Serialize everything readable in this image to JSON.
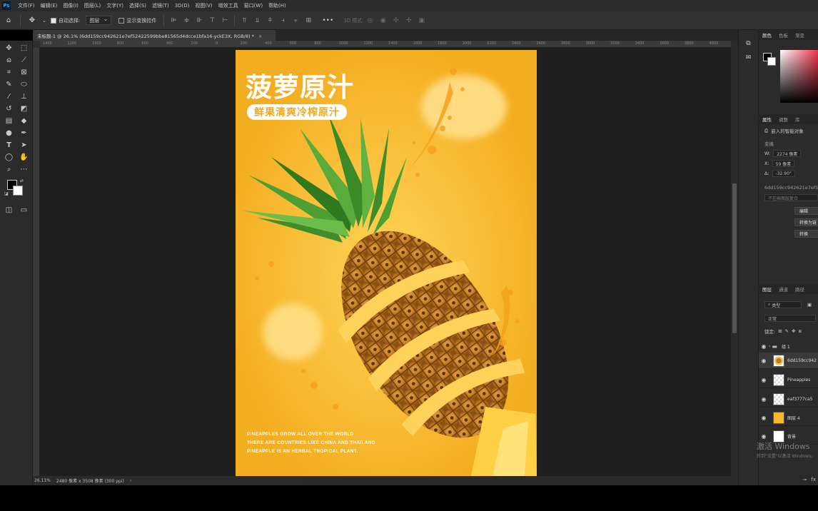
{
  "menubar": {
    "app_logo": "Ps",
    "items": [
      "文件(F)",
      "编辑(E)",
      "图像(I)",
      "图层(L)",
      "文字(Y)",
      "选择(S)",
      "滤镜(T)",
      "3D(D)",
      "视图(V)",
      "增效工具",
      "窗口(W)",
      "帮助(H)"
    ]
  },
  "options": {
    "auto_select_label": "自动选择:",
    "auto_select_target": "图层",
    "show_transform_label": "显示变换控件",
    "more": "•••",
    "mode_3d": "3D 模式:"
  },
  "tab": {
    "title": "未标题-1 @ 26.1% (6dd159cc942621e7ef52422599bbe81565d4dcce1bfa16-yckE3X, RGB/8) *",
    "close": "×"
  },
  "ruler": {
    "labels": [
      "1400",
      "1200",
      "1000",
      "800",
      "600",
      "400",
      "200",
      "0",
      "200",
      "400",
      "600",
      "800",
      "1000",
      "1200",
      "1400",
      "1600",
      "1800",
      "2000",
      "2200",
      "2400",
      "2600",
      "2800",
      "3000",
      "3200",
      "3400",
      "3600",
      "3800",
      "4000"
    ]
  },
  "status": {
    "zoom": "26.11%",
    "doc_size": "2480 像素 x 3508 像素 (300 ppi)",
    "arrow": "›"
  },
  "poster": {
    "title": "菠萝原汁",
    "subtitle": "鲜果清爽冷榨原汁",
    "copy_line1": "PINEAPPLES GROW ALL OVER THE WORLD",
    "copy_line2": "THERE ARE COUNTRIES LIKE CHINA AND THAILAND",
    "copy_line3": "PINEAPPLE IS AN HERBAL TROPICAL PLANT."
  },
  "color_panel": {
    "tabs": [
      "颜色",
      "色板",
      "渐变"
    ]
  },
  "properties": {
    "tabs": [
      "属性",
      "调整",
      "库"
    ],
    "object_type": "嵌入的智能对象",
    "transform_label": "变换",
    "w_label": "W:",
    "w_value": "2274 像素",
    "x_label": "X:",
    "x_value": "59 像素",
    "angle_label": "∆:",
    "angle_value": "-32.90°",
    "file_name": "6dd159cc942621e7ef52",
    "comp_placeholder": "不在画图层复合",
    "btn_edit": "编辑",
    "btn_convert_link": "转换为链",
    "btn_convert": "转换"
  },
  "layers": {
    "tabs": [
      "图层",
      "通道",
      "路径"
    ],
    "filter_kind": "类型",
    "blend_mode": "正常",
    "lock_label": "锁定:",
    "items": [
      {
        "name": "组 1"
      },
      {
        "name": "6dd159cc942"
      },
      {
        "name": "Pineapples"
      },
      {
        "name": "eaf3777ca5"
      },
      {
        "name": "图层 4"
      },
      {
        "name": "背景"
      }
    ]
  },
  "watermark": {
    "line1": "激活 Windows",
    "line2": "转到\"设置\"以激活 Windows。"
  },
  "colors": {
    "poster_bg": "#f6b82a",
    "canvas_bg": "#1e1e1e",
    "panel_bg": "#2b2b2b"
  }
}
